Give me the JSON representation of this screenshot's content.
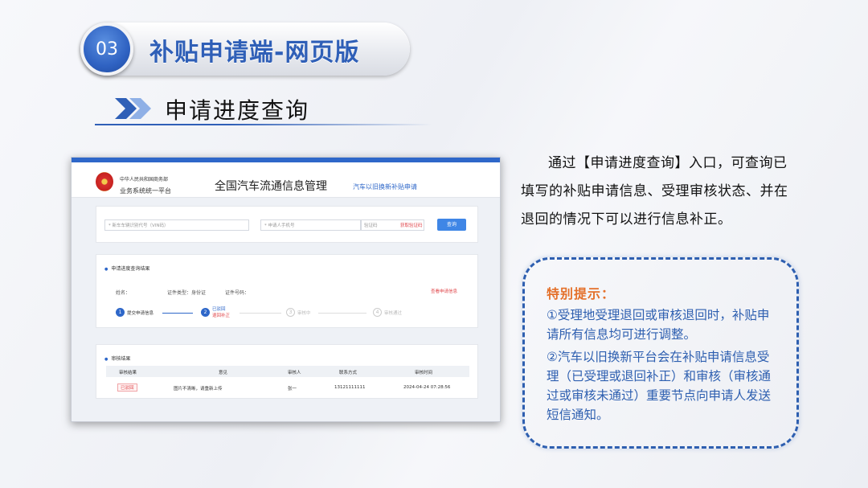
{
  "section": {
    "number": "03",
    "title": "补贴申请端-网页版",
    "subtitle": "申请进度查询"
  },
  "screenshot": {
    "org_line1": "中华人民共和国商务部",
    "org_line2": "业务系统统一平台",
    "system_title": "全国汽车流通信息管理",
    "system_subtitle": "汽车以旧换新补贴申请",
    "vin_placeholder": "* 新车车辆识别代号（VIN码）",
    "phone_placeholder": "* 申请人手机号",
    "code_placeholder": "验证码",
    "get_code_label": "获取验证码",
    "query_label": "查询",
    "progress_title": "申请进度查询结果",
    "name_label": "姓名：",
    "id_type_label": "证件类型：身份证",
    "id_number_label": "证件号码：",
    "modify_link": "查看申请信息",
    "steps": [
      {
        "num": "1",
        "label": "提交申请信息",
        "sub": ""
      },
      {
        "num": "2",
        "label": "已驳回",
        "sub": "退回补正"
      },
      {
        "num": "3",
        "label": "审核中",
        "sub": ""
      },
      {
        "num": "4",
        "label": "审核通过",
        "sub": ""
      }
    ],
    "review_title": "审核结果",
    "table_headers": [
      "审核结果",
      "意见",
      "审核人",
      "联系方式",
      "审核时间"
    ],
    "table_row": [
      "已驳回",
      "图片不清晰，请重新上传",
      "张一",
      "13121111111",
      "2024-04-24 07:28:56"
    ]
  },
  "intro_text": "通过【申请进度查询】入口，可查询已填写的补贴申请信息、受理审核状态、并在退回的情况下可以进行信息补正。",
  "notice": {
    "title": "特别提示：",
    "item1": "①受理地受理退回或审核退回时，补贴申请所有信息均可进行调整。",
    "item2": "②汽车以旧换新平台会在补贴申请信息受理（已受理或退回补正）和审核（审核通过或审核未通过）重要节点向申请人发送短信通知。"
  },
  "colors": {
    "accent_blue": "#2f5fb7",
    "notice_orange": "#e4702a",
    "alert_red": "#e0454a"
  }
}
